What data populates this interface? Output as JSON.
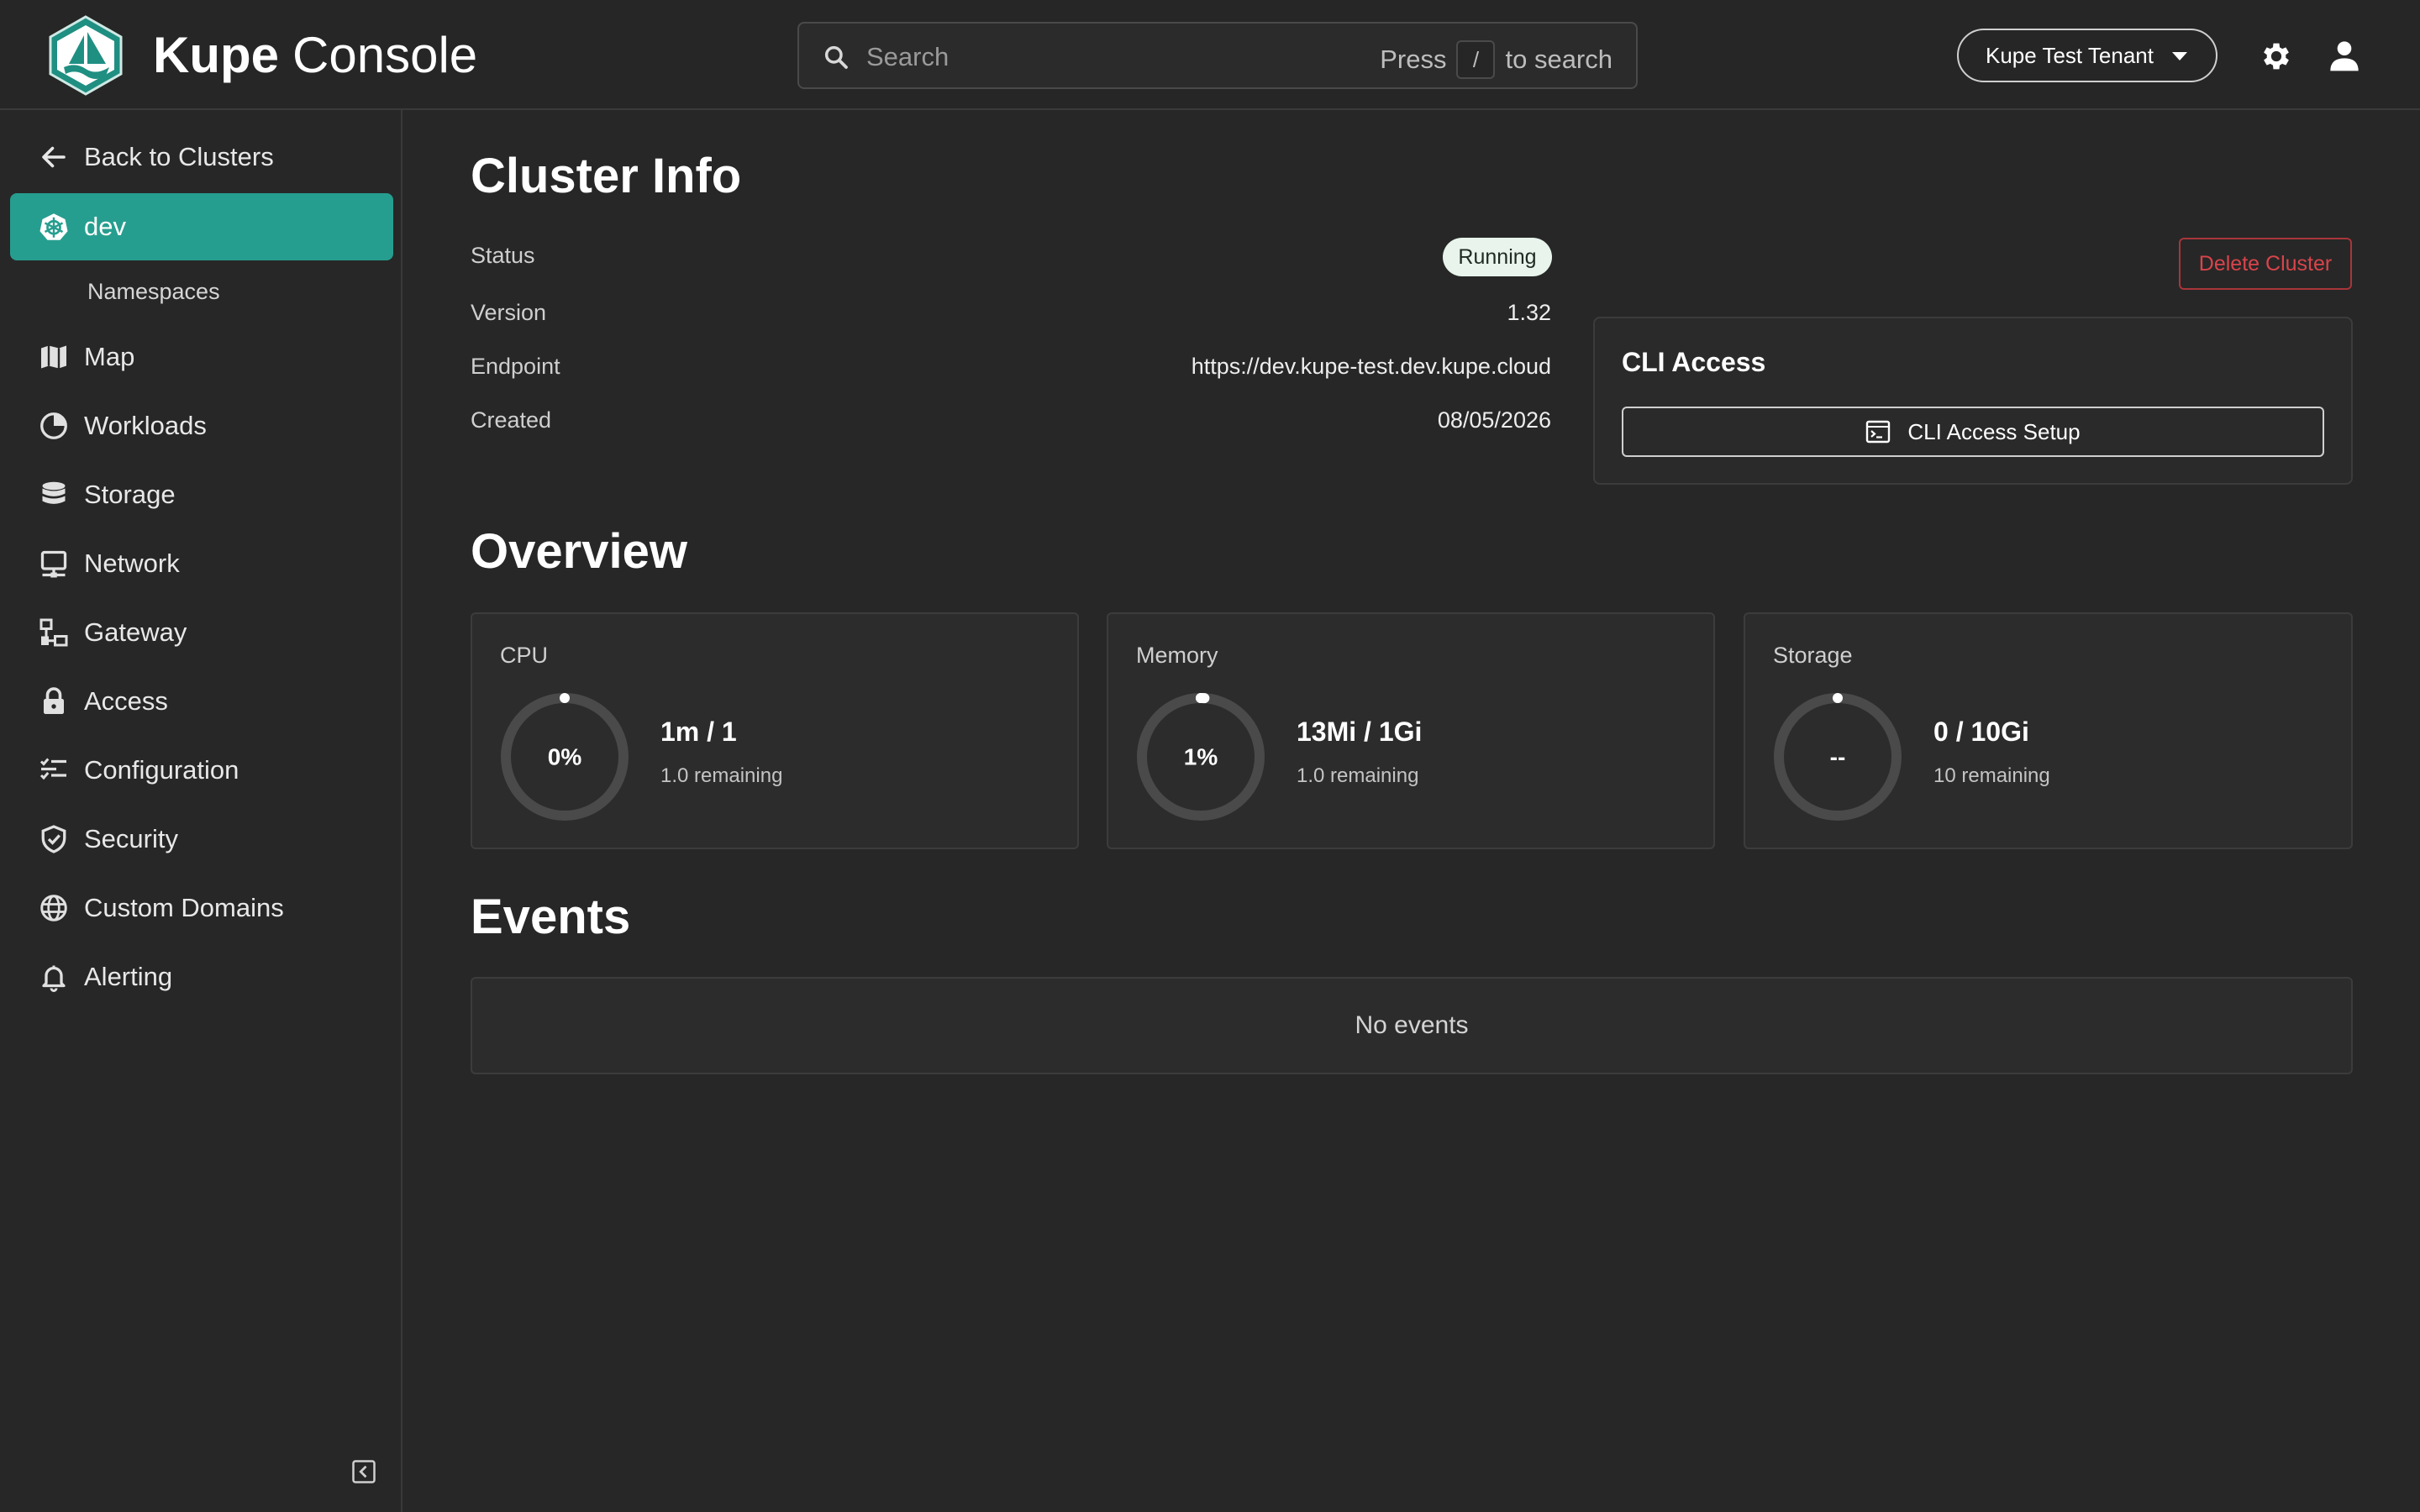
{
  "colors": {
    "accent": "#269e8f",
    "danger": "#d9444b",
    "running_badge_bg": "#e8f4ec",
    "background": "#272727"
  },
  "header": {
    "brand_bold": "Kupe",
    "brand_light": "Console",
    "logo_icon": "ship-wave-logo",
    "search": {
      "placeholder": "Search",
      "hint_prefix": "Press",
      "hint_key": "/",
      "hint_suffix": "to search"
    },
    "tenant_selector": "Kupe Test Tenant",
    "settings_icon": "gear-icon",
    "user_icon": "person-icon"
  },
  "sidebar": {
    "back_label": "Back to Clusters",
    "cluster": "dev",
    "sub_items": [
      "Namespaces"
    ],
    "items": [
      {
        "label": "Map",
        "icon": "map-icon"
      },
      {
        "label": "Workloads",
        "icon": "pie-icon"
      },
      {
        "label": "Storage",
        "icon": "database-icon"
      },
      {
        "label": "Network",
        "icon": "network-icon"
      },
      {
        "label": "Gateway",
        "icon": "gateway-icon"
      },
      {
        "label": "Access",
        "icon": "lock-icon"
      },
      {
        "label": "Configuration",
        "icon": "checklist-icon"
      },
      {
        "label": "Security",
        "icon": "shield-icon"
      },
      {
        "label": "Custom Domains",
        "icon": "globe-icon"
      },
      {
        "label": "Alerting",
        "icon": "bell-icon"
      }
    ]
  },
  "cluster_info": {
    "title": "Cluster Info",
    "status_label": "Status",
    "status_value": "Running",
    "version_label": "Version",
    "version_value": "1.32",
    "endpoint_label": "Endpoint",
    "endpoint_value": "https://dev.kupe-test.dev.kupe.cloud",
    "created_label": "Created",
    "created_value": "08/05/2026",
    "delete_label": "Delete Cluster",
    "cli": {
      "title": "CLI Access",
      "button_label": "CLI Access Setup"
    }
  },
  "overview": {
    "title": "Overview",
    "metrics": [
      {
        "label": "CPU",
        "center": "0%",
        "usage": "1m / 1",
        "remaining": "1.0 remaining",
        "fraction": 0.0
      },
      {
        "label": "Memory",
        "center": "1%",
        "usage": "13Mi / 1Gi",
        "remaining": "1.0 remaining",
        "fraction": 0.01
      },
      {
        "label": "Storage",
        "center": "--",
        "usage": "0 / 10Gi",
        "remaining": "10 remaining",
        "fraction": 0.0
      }
    ]
  },
  "events": {
    "title": "Events",
    "empty_text": "No events"
  }
}
